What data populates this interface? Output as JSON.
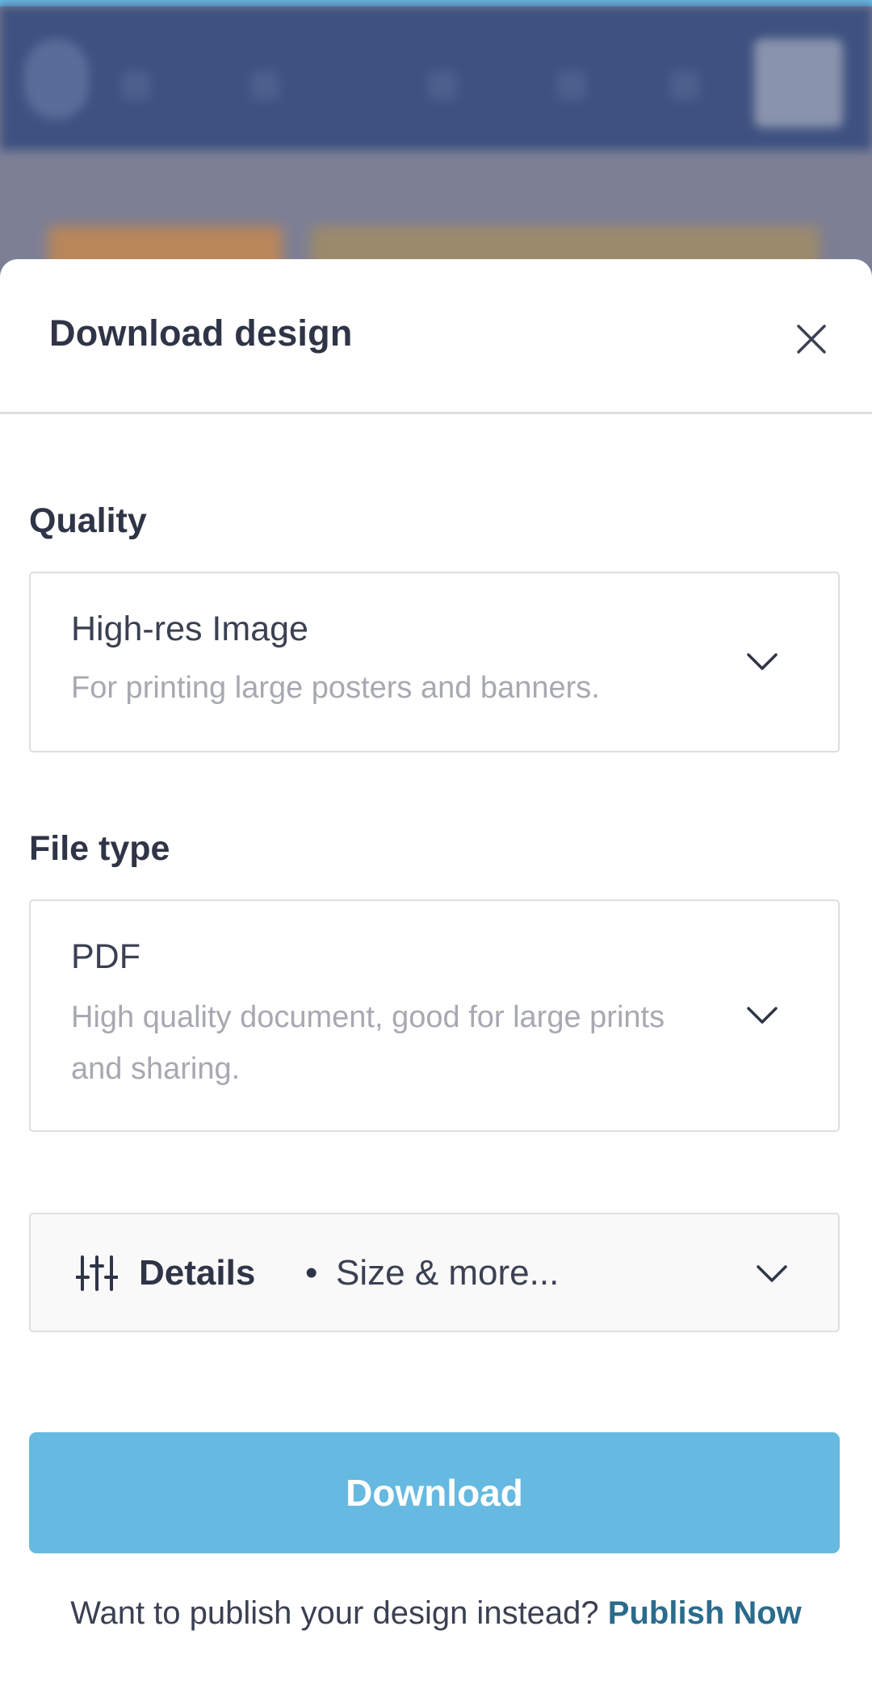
{
  "background": {
    "accent_color": "#67b9e1",
    "toolbar_color": "#3e5180"
  },
  "sheet": {
    "title": "Download design",
    "close_icon": "close-icon"
  },
  "quality": {
    "label": "Quality",
    "selected_title": "High-res Image",
    "selected_description": "For printing large posters and banners.",
    "chevron_icon": "chevron-down-icon"
  },
  "file_type": {
    "label": "File type",
    "selected_title": "PDF",
    "selected_description": "High quality document, good for large prints and sharing.",
    "chevron_icon": "chevron-down-icon"
  },
  "details": {
    "icon": "sliders-icon",
    "label": "Details",
    "separator": "•",
    "sublabel": "Size & more...",
    "chevron_icon": "chevron-down-icon"
  },
  "download_button": {
    "label": "Download",
    "color": "#66b9e0"
  },
  "footer": {
    "prompt": "Want to publish your design instead?",
    "link_label": "Publish Now",
    "link_color": "#2b6b8c"
  }
}
